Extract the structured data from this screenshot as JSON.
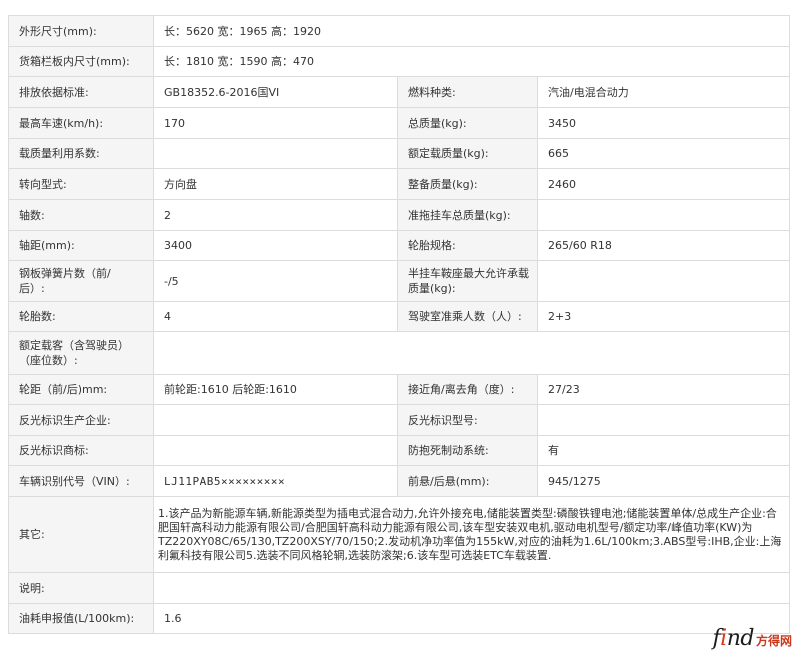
{
  "spec_table": {
    "rows": [
      {
        "label": "外形尺寸(mm):",
        "value": "长：5620 宽：1965 高：1920"
      },
      {
        "label": "货箱栏板内尺寸(mm):",
        "value": "长：1810 宽：1590 高：470"
      },
      {
        "label": "排放依据标准:",
        "value": "GB18352.6-2016国VI",
        "label2": "燃料种类:",
        "value2": "汽油/电混合动力"
      },
      {
        "label": "最高车速(km/h):",
        "value": "170",
        "label2": "总质量(kg):",
        "value2": "3450"
      },
      {
        "label": "载质量利用系数:",
        "value": "",
        "label2": "额定载质量(kg):",
        "value2": "665"
      },
      {
        "label": "转向型式:",
        "value": "方向盘",
        "label2": "整备质量(kg):",
        "value2": "2460"
      },
      {
        "label": "轴数:",
        "value": "2",
        "label2": "准拖挂车总质量(kg):",
        "value2": ""
      },
      {
        "label": "轴距(mm):",
        "value": "3400",
        "label2": "轮胎规格:",
        "value2": "265/60 R18"
      },
      {
        "label": "钢板弹簧片数（前/\n后）:",
        "value": "-/5",
        "label2": "半挂车鞍座最大允许承载\n质量(kg):",
        "value2": ""
      },
      {
        "label": "轮胎数:",
        "value": "4",
        "label2": "驾驶室准乘人数（人）:",
        "value2": "2+3"
      },
      {
        "label": "额定载客（含驾驶员）\n（座位数）:",
        "value": ""
      },
      {
        "label": "轮距（前/后)mm:",
        "value": "前轮距:1610 后轮距:1610",
        "label2": "接近角/离去角（度）:",
        "value2": "27/23"
      },
      {
        "label": "反光标识生产企业:",
        "value": "",
        "label2": "反光标识型号:",
        "value2": ""
      },
      {
        "label": "反光标识商标:",
        "value": "",
        "label2": "防抱死制动系统:",
        "value2": "有"
      },
      {
        "label": "车辆识别代号（VIN）:",
        "value": "LJ11PAB5×××××××××",
        "label2": "前悬/后悬(mm):",
        "value2": "945/1275"
      },
      {
        "label": "其它:",
        "value": "1.该产品为新能源车辆,新能源类型为插电式混合动力,允许外接充电,储能装置类型:磷酸铁锂电池;储能装置单体/总成生产企业:合肥国轩高科动力能源有限公司/合肥国轩高科动力能源有限公司,该车型安装双电机,驱动电机型号/额定功率/峰值功率(KW)为TZ220XY08C/65/130,TZ200XSY/70/150;2.发动机净功率值为155kW,对应的油耗为1.6L/100km;3.ABS型号:IHB,企业:上海利氟科技有限公司5.选装不同风格轮辋,选装防滚架;6.该车型可选装ETC车载装置."
      },
      {
        "label": "说明:",
        "value": ""
      },
      {
        "label": "油耗申报值(L/100km):",
        "value": "1.6"
      }
    ]
  },
  "watermark": {
    "brand_en_1": "f",
    "brand_en_i": "i",
    "brand_en_2": "nd",
    "brand_cn": "方得网"
  }
}
